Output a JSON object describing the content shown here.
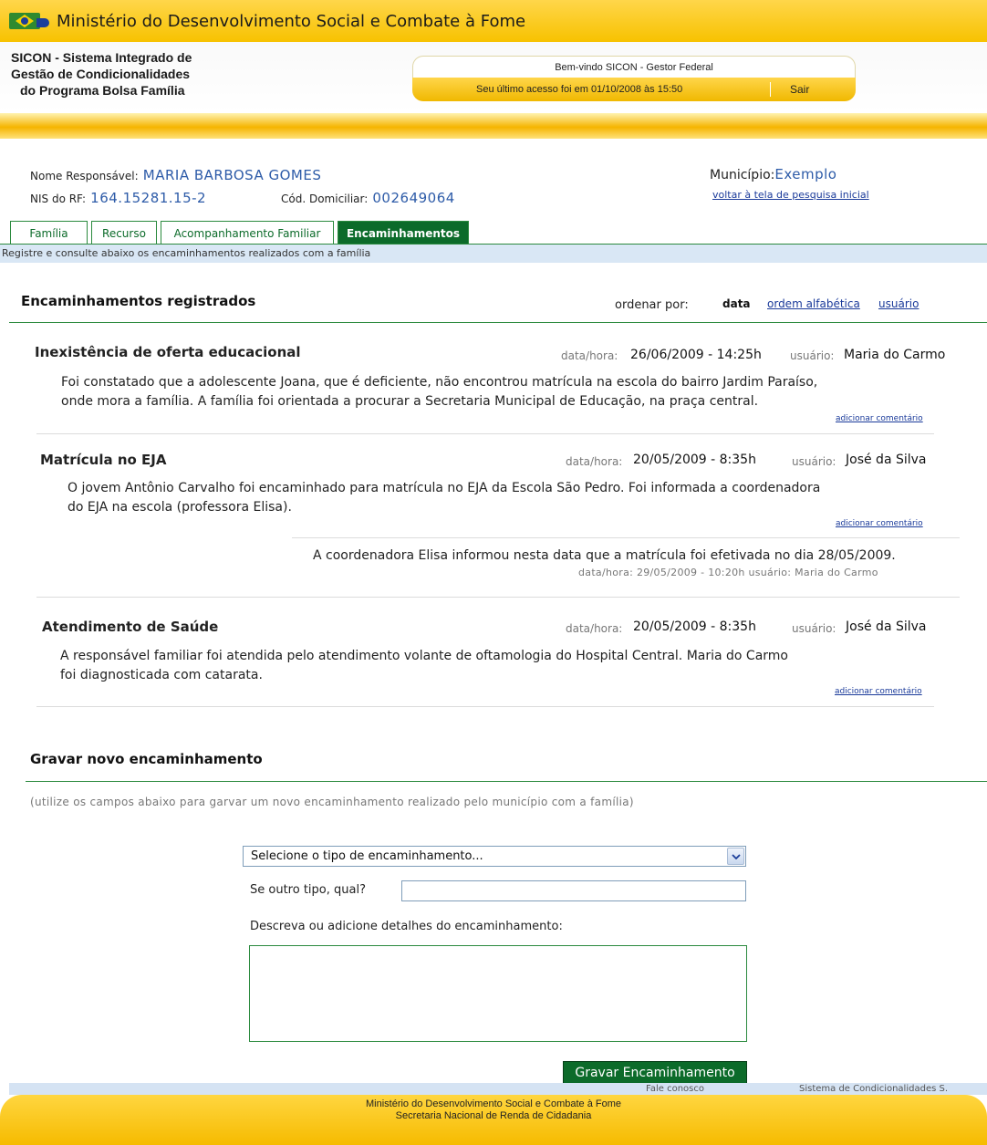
{
  "header": {
    "ministry_title": "Ministério do Desenvolvimento Social e Combate à Fome",
    "system_title_lines": [
      "SICON - Sistema Integrado de",
      "Gestão de Condicionalidades",
      "do Programa Bolsa Família"
    ],
    "welcome": "Bem-vindo SICON - Gestor Federal",
    "last_access": "Seu último acesso foi em 01/10/2008 às 15:50",
    "logout": "Sair",
    "logo_icon": "brazil-flag-icon"
  },
  "family": {
    "name_label": "Nome Responsável:",
    "name_value": "MARIA BARBOSA GOMES",
    "nis_label": "NIS do RF:",
    "nis_value": "164.15281.15-2",
    "cod_label": "Cód. Domiciliar:",
    "cod_value": "002649064",
    "municipio_label": "Município:",
    "municipio_value": "Exemplo",
    "back_link": "voltar à tela de pesquisa inicial"
  },
  "tabs": [
    {
      "label": "Família",
      "active": false
    },
    {
      "label": "Recurso",
      "active": false
    },
    {
      "label": "Acompanhamento Familiar",
      "active": false
    },
    {
      "label": "Encaminhamentos",
      "active": true
    }
  ],
  "tab_description": "Registre e consulte abaixo os encaminhamentos realizados com a família",
  "registered": {
    "title": "Encaminhamentos registrados",
    "order_by_label": "ordenar por:",
    "order_options": [
      "data",
      "ordem alfabética",
      "usuário"
    ],
    "date_label": "data/hora:",
    "user_label": "usuário:",
    "add_comment": "adicionar comentário",
    "entries": [
      {
        "title": "Inexistência de oferta educacional",
        "datetime": "26/06/2009  -  14:25h",
        "user": "Maria do Carmo",
        "text_lines": [
          "Foi constatado que a adolescente Joana, que é deficiente, não encontrou matrícula na escola do bairro Jardim Paraíso,",
          "onde mora a família. A família foi orientada a procurar a Secretaria Municipal de Educação, na praça central."
        ]
      },
      {
        "title": "Matrícula no EJA",
        "datetime": "20/05/2009 - 8:35h",
        "user": "José da Silva",
        "text_lines": [
          "O jovem Antônio Carvalho foi encaminhado para matrícula no EJA da Escola São Pedro. Foi informada a coordenadora",
          "do EJA na escola (professora Elisa)."
        ],
        "comment": {
          "text": "A coordenadora Elisa informou nesta data que a matrícula foi efetivada no dia 28/05/2009.",
          "meta": "data/hora: 29/05/2009 - 10:20h    usuário: Maria do Carmo"
        }
      },
      {
        "title": "Atendimento de Saúde",
        "datetime": "20/05/2009 - 8:35h",
        "user": "José da Silva",
        "text_lines": [
          "A responsável familiar foi atendida pelo atendimento volante de oftamologia do Hospital Central. Maria do Carmo",
          "foi diagnosticada com catarata."
        ]
      }
    ]
  },
  "new_entry": {
    "title": "Gravar novo encaminhamento",
    "hint": "(utilize os campos abaixo para garvar um novo encaminhamento realizado pelo município com a família)",
    "select_value": "Selecione o tipo de encaminhamento...",
    "other_label": "Se outro tipo, qual?",
    "other_value": "",
    "details_label": "Descreva ou adicione detalhes do encaminhamento:",
    "details_value": "",
    "save_button": "Gravar Encaminhamento"
  },
  "footer": {
    "contact": "Fale conosco",
    "system_name": "Sistema de Condicionalidades S.",
    "line1": "Ministério do Desenvolvimento Social e Combate à Fome",
    "line2": "Secretaria Nacional de Renda de Cidadania"
  }
}
